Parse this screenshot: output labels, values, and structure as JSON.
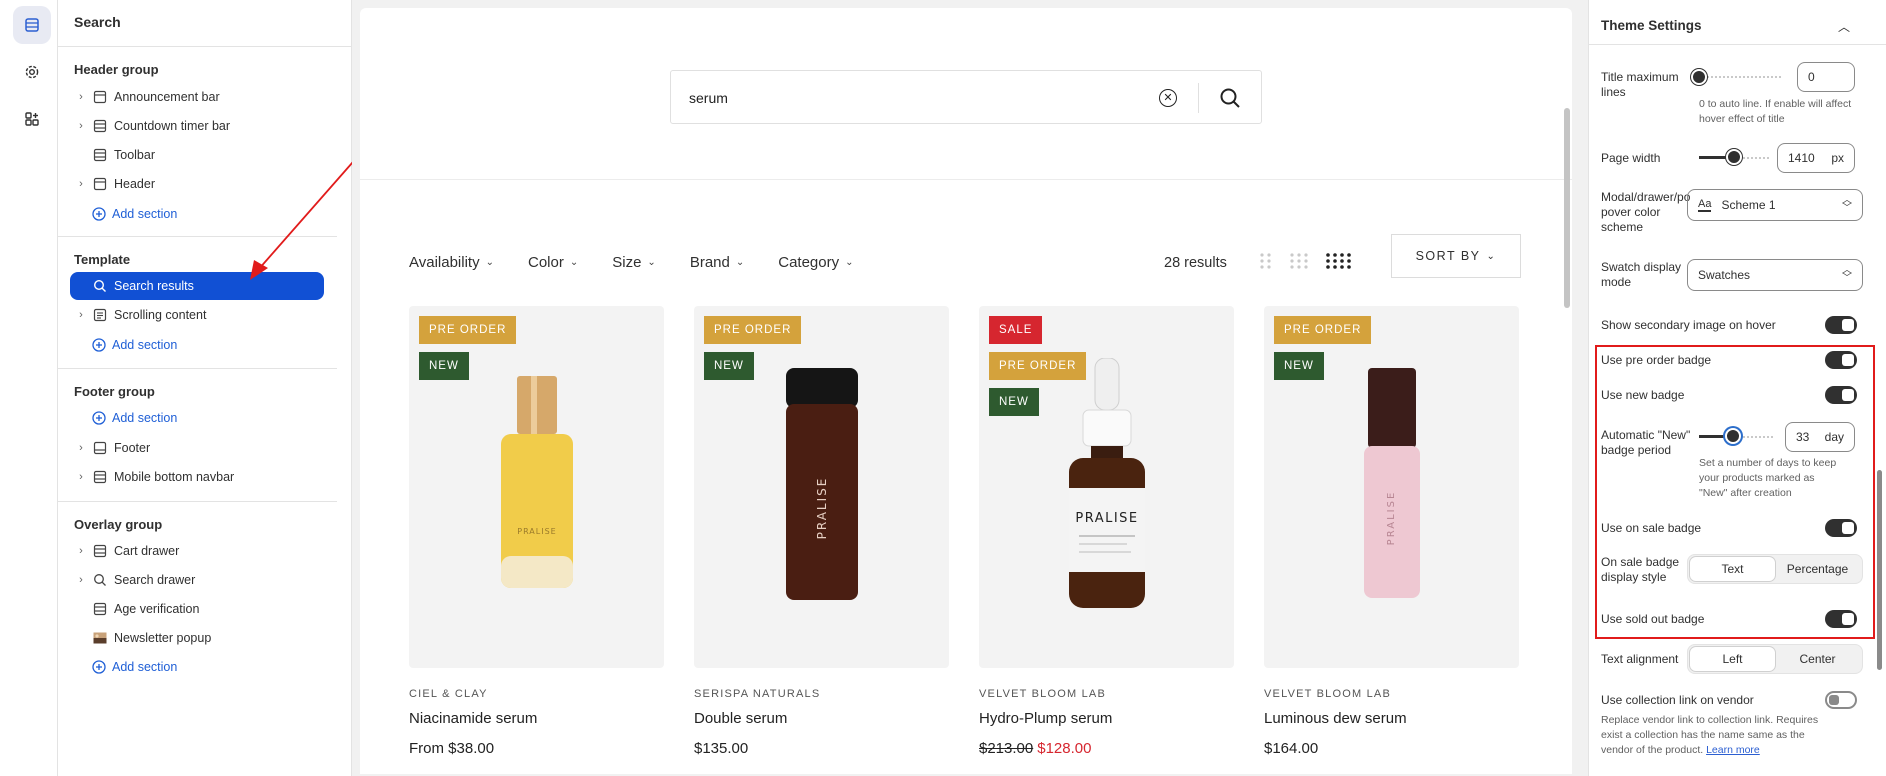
{
  "rail": {
    "icons": [
      "sections-icon",
      "settings-gear-icon",
      "apps-icon"
    ]
  },
  "left_panel": {
    "title": "Search",
    "groups": {
      "header": {
        "title": "Header group",
        "items": [
          "Announcement bar",
          "Countdown timer bar",
          "Toolbar",
          "Header"
        ],
        "add": "Add section"
      },
      "template": {
        "title": "Template",
        "items": [
          "Search results",
          "Scrolling content"
        ],
        "add": "Add section"
      },
      "footer": {
        "title": "Footer group",
        "add": "Add section",
        "items": [
          "Footer",
          "Mobile bottom navbar"
        ]
      },
      "overlay": {
        "title": "Overlay group",
        "items": [
          "Cart drawer",
          "Search drawer",
          "Age verification",
          "Newsletter popup"
        ],
        "add": "Add section"
      }
    }
  },
  "store": {
    "search_value": "serum",
    "filters": [
      "Availability",
      "Color",
      "Size",
      "Brand",
      "Category"
    ],
    "results": "28 results",
    "sort_label": "SORT BY",
    "products": [
      {
        "badges": [
          "PRE ORDER",
          "NEW"
        ],
        "vendor": "CIEL & CLAY",
        "name": "Niacinamide serum",
        "price": "From $38.00",
        "old_price": "",
        "sale_price": "",
        "bottle_label": "PRALISE"
      },
      {
        "badges": [
          "PRE ORDER",
          "NEW"
        ],
        "vendor": "SERISPA NATURALS",
        "name": "Double serum",
        "price": "$135.00",
        "old_price": "",
        "sale_price": "",
        "bottle_label": "PRALISE"
      },
      {
        "badges": [
          "SALE",
          "PRE ORDER",
          "NEW"
        ],
        "vendor": "VELVET BLOOM LAB",
        "name": "Hydro-Plump serum",
        "price": "",
        "old_price": "$213.00",
        "sale_price": "$128.00",
        "bottle_label": "PRALISE"
      },
      {
        "badges": [
          "PRE ORDER",
          "NEW"
        ],
        "vendor": "VELVET BLOOM LAB",
        "name": "Luminous dew serum",
        "price": "$164.00",
        "old_price": "",
        "sale_price": "",
        "bottle_label": "PRALISE"
      }
    ]
  },
  "right_panel": {
    "title": "Theme Settings",
    "title_max_lines": {
      "label": "Title maximum lines",
      "value": "0",
      "help": "0 to auto line. If enable will affect hover effect of title",
      "level": 0
    },
    "page_width": {
      "label": "Page width",
      "value": "1410",
      "unit": "px",
      "level": 0.5
    },
    "modal_scheme": {
      "label": "Modal/drawer/popover color scheme",
      "label_lines": [
        "Modal/drawer/po",
        "pover color",
        "scheme"
      ],
      "value": "Scheme 1",
      "swatch_text": "Aa"
    },
    "swatch_mode": {
      "label_lines": [
        "Swatch display",
        "mode"
      ],
      "value": "Swatches"
    },
    "secondary_image": {
      "label": "Show secondary image on hover",
      "on": true
    },
    "pre_order_badge": {
      "label": "Use pre order badge",
      "on": true
    },
    "new_badge": {
      "label": "Use new badge",
      "on": true
    },
    "auto_new": {
      "label_lines": [
        "Automatic \"New\"",
        "badge period"
      ],
      "value": "33",
      "unit": "day",
      "help_lines": [
        "Set a number of days to keep",
        "your products marked as",
        "\"New\" after creation"
      ],
      "level": 0.45
    },
    "sale_badge": {
      "label": "Use on sale badge",
      "on": true
    },
    "sale_style": {
      "label_lines": [
        "On sale badge",
        "display style"
      ],
      "options": [
        "Text",
        "Percentage"
      ],
      "selected": "Text"
    },
    "sold_out_badge": {
      "label": "Use sold out badge",
      "on": true
    },
    "text_alignment": {
      "label": "Text alignment",
      "options": [
        "Left",
        "Center"
      ],
      "selected": "Left"
    },
    "collection_link": {
      "label": "Use collection link on vendor",
      "on": false,
      "help_lines": [
        "Replace vendor link to collection link. Requires",
        "exist a collection has the name same as the",
        "vendor of the product."
      ],
      "learn_more": "Learn more"
    },
    "colors": {
      "highlight": "#e11b1b",
      "selected": "#1150d4",
      "link": "#2c5fd1"
    }
  }
}
